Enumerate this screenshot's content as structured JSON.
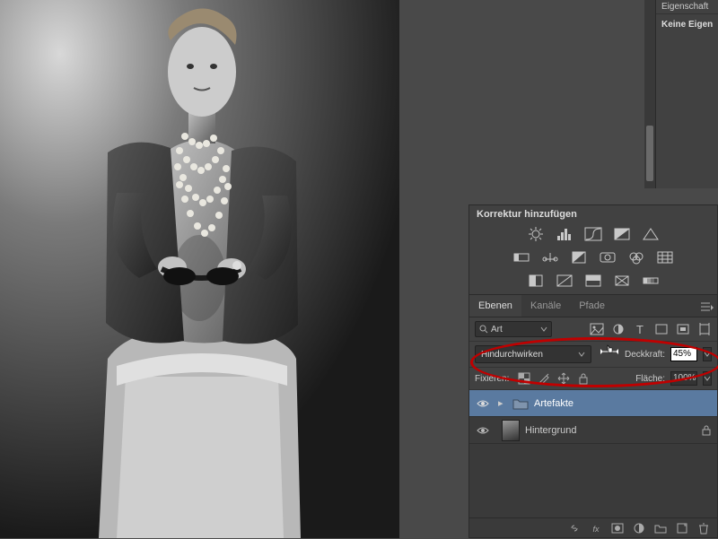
{
  "properties_panel": {
    "heading": "Eigenschaft",
    "subtitle": "Keine Eigen"
  },
  "adjustments": {
    "title": "Korrektur hinzufügen",
    "row1": [
      "brightness",
      "levels",
      "curves",
      "exposure",
      "vibrance"
    ],
    "row2": [
      "hue",
      "balance",
      "bw",
      "photo-filter",
      "channel-mixer",
      "color-lookup"
    ],
    "row3": [
      "invert",
      "posterize",
      "threshold",
      "selective-color",
      "gradient-map"
    ]
  },
  "layers_panel": {
    "tabs": {
      "layers": "Ebenen",
      "channels": "Kanäle",
      "paths": "Pfade"
    },
    "filter": {
      "label": "Art",
      "icons": [
        "pixel",
        "adjust",
        "type",
        "shape",
        "smart",
        "artboard"
      ]
    },
    "blend_mode": "Hindurchwirken",
    "opacity": {
      "label": "Deckkraft:",
      "value": "45%"
    },
    "lock": {
      "label": "Fixieren:"
    },
    "fill": {
      "label": "Fläche:",
      "value": "100%"
    },
    "layers": [
      {
        "name": "Artefakte",
        "type": "group",
        "selected": true
      },
      {
        "name": "Hintergrund",
        "type": "pixel",
        "locked": true
      }
    ],
    "bottom_icons": [
      "link",
      "fx",
      "mask",
      "adjust",
      "group",
      "new",
      "delete"
    ]
  }
}
